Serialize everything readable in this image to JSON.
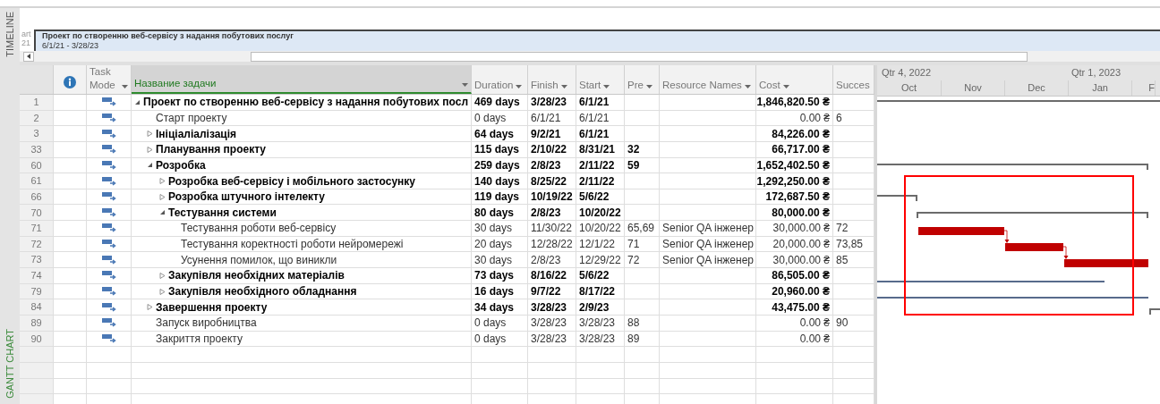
{
  "timeline": {
    "label": "TIMELINE",
    "cut_texts": [
      "art",
      "21"
    ],
    "bar": {
      "title": "Проект по створенню веб-сервісу з надання побутових послуг",
      "dates": "6/1/21 - 3/28/23"
    }
  },
  "view_label": "GANTT CHART",
  "table": {
    "columns": [
      {
        "label": "Task Mode",
        "menu": true,
        "selected": false
      },
      {
        "label": "Название задачи",
        "menu": true,
        "selected": true
      },
      {
        "label": "Duration",
        "menu": true,
        "selected": false
      },
      {
        "label": "Finish",
        "menu": true,
        "selected": false
      },
      {
        "label": "Start",
        "menu": true,
        "selected": false
      },
      {
        "label": "Pre",
        "menu": true,
        "selected": false
      },
      {
        "label": "Resource Names",
        "menu": true,
        "selected": false
      },
      {
        "label": "Cost",
        "menu": true,
        "selected": false
      },
      {
        "label": "Succes",
        "menu": false,
        "selected": false
      }
    ],
    "tasks": [
      {
        "id": "1",
        "kind": "summary",
        "expanded": true,
        "name": "Проект по створенню веб-сервісу з надання побутових посл",
        "duration": "469 days",
        "finish": "3/28/23",
        "start": "6/1/21",
        "cost": "1,846,820.50 ₴",
        "children": [
          {
            "id": "2",
            "kind": "task",
            "name": "Старт проекту",
            "duration": "0 days",
            "finish": "6/1/21",
            "start": "6/1/21",
            "cost": "0.00 ₴",
            "successors": "6"
          },
          {
            "id": "3",
            "kind": "summary",
            "expanded": false,
            "name": "Ініціаліалізація",
            "duration": "64 days",
            "finish": "9/2/21",
            "start": "6/1/21",
            "cost": "84,226.00 ₴"
          },
          {
            "id": "33",
            "kind": "summary",
            "expanded": false,
            "name": "Планування проекту",
            "duration": "115 days",
            "finish": "2/10/22",
            "start": "8/31/21",
            "predecessors": "32",
            "cost": "66,717.00 ₴"
          },
          {
            "id": "60",
            "kind": "summary",
            "expanded": true,
            "name": "Розробка",
            "duration": "259 days",
            "finish": "2/8/23",
            "start": "2/11/22",
            "predecessors": "59",
            "cost": "1,652,402.50 ₴",
            "children": [
              {
                "id": "61",
                "kind": "summary",
                "expanded": false,
                "name": "Розробка веб-сервісу і мобільного застосунку",
                "duration": "140 days",
                "finish": "8/25/22",
                "start": "2/11/22",
                "cost": "1,292,250.00 ₴"
              },
              {
                "id": "66",
                "kind": "summary",
                "expanded": false,
                "name": "Розробка штучного інтелекту",
                "duration": "119 days",
                "finish": "10/19/22",
                "start": "5/6/22",
                "cost": "172,687.50 ₴"
              },
              {
                "id": "70",
                "kind": "summary",
                "expanded": true,
                "name": "Тестування системи",
                "duration": "80 days",
                "finish": "2/8/23",
                "start": "10/20/22",
                "cost": "80,000.00 ₴",
                "children": [
                  {
                    "id": "71",
                    "kind": "task",
                    "name": "Тестування роботи веб-сервісу",
                    "duration": "30 days",
                    "finish": "11/30/22",
                    "start": "10/20/22",
                    "predecessors": "65,69",
                    "resource": "Senior QA інженер",
                    "cost": "30,000.00 ₴",
                    "successors": "72"
                  },
                  {
                    "id": "72",
                    "kind": "task",
                    "name": "Тестування коректності роботи нейромережі",
                    "duration": "20 days",
                    "finish": "12/28/22",
                    "start": "12/1/22",
                    "predecessors": "71",
                    "resource": "Senior QA інженер",
                    "cost": "20,000.00 ₴",
                    "successors": "73,85"
                  },
                  {
                    "id": "73",
                    "kind": "task",
                    "name": "Усунення помилок, що виникли",
                    "duration": "30 days",
                    "finish": "2/8/23",
                    "start": "12/29/22",
                    "predecessors": "72",
                    "resource": "Senior QA інженер",
                    "cost": "30,000.00 ₴",
                    "successors": "85"
                  }
                ]
              },
              {
                "id": "74",
                "kind": "summary",
                "expanded": false,
                "name": "Закупівля необхідних матеріалів",
                "duration": "73 days",
                "finish": "8/16/22",
                "start": "5/6/22",
                "cost": "86,505.00 ₴"
              },
              {
                "id": "79",
                "kind": "summary",
                "expanded": false,
                "name": "Закупівля необхідного обладнання",
                "duration": "16 days",
                "finish": "9/7/22",
                "start": "8/17/22",
                "cost": "20,960.00 ₴"
              }
            ]
          },
          {
            "id": "84",
            "kind": "summary",
            "expanded": false,
            "name": "Завершення проекту",
            "duration": "34 days",
            "finish": "3/28/23",
            "start": "2/9/23",
            "cost": "43,475.00 ₴"
          },
          {
            "id": "89",
            "kind": "task",
            "name": "Запуск виробництва",
            "duration": "0 days",
            "finish": "3/28/23",
            "start": "3/28/23",
            "predecessors": "88",
            "cost": "0.00 ₴",
            "successors": "90"
          },
          {
            "id": "90",
            "kind": "task",
            "name": "Закриття проекту",
            "duration": "0 days",
            "finish": "3/28/23",
            "start": "3/28/23",
            "predecessors": "89",
            "cost": "0.00 ₴"
          }
        ]
      }
    ]
  },
  "gantt": {
    "quarters": [
      "Qtr 4, 2022",
      "Qtr 1, 2023"
    ],
    "months": [
      "Oct",
      "Nov",
      "Dec",
      "Jan",
      "F"
    ]
  }
}
